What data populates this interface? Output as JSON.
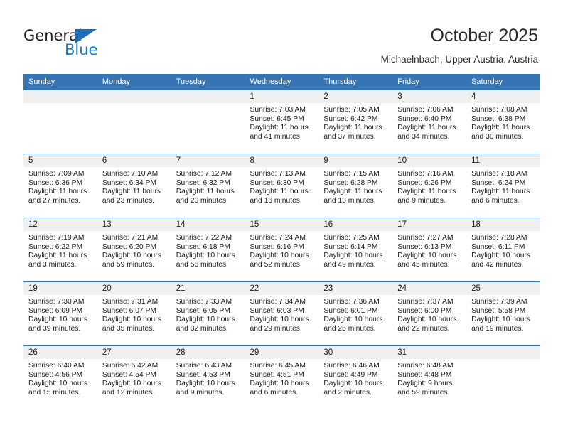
{
  "brand": {
    "name_part1": "General",
    "name_part2": "Blue",
    "triangle_color": "#1f6eb5",
    "blue_color": "#1d7cc4"
  },
  "header": {
    "title": "October 2025",
    "subtitle": "Michaelnbach, Upper Austria, Austria"
  },
  "theme": {
    "header_bg": "#3575b6",
    "daynum_bg": "#f0f0f0",
    "grid_line": "#3575b6",
    "text": "#1a1a1a"
  },
  "columns": [
    "Sunday",
    "Monday",
    "Tuesday",
    "Wednesday",
    "Thursday",
    "Friday",
    "Saturday"
  ],
  "weeks": [
    [
      {
        "day": "",
        "blank": true,
        "sunrise": "",
        "sunset": "",
        "daylight_line1": "",
        "daylight_line2": ""
      },
      {
        "day": "",
        "blank": true,
        "sunrise": "",
        "sunset": "",
        "daylight_line1": "",
        "daylight_line2": ""
      },
      {
        "day": "",
        "blank": true,
        "sunrise": "",
        "sunset": "",
        "daylight_line1": "",
        "daylight_line2": ""
      },
      {
        "day": "1",
        "blank": false,
        "sunrise": "Sunrise: 7:03 AM",
        "sunset": "Sunset: 6:45 PM",
        "daylight_line1": "Daylight: 11 hours",
        "daylight_line2": "and 41 minutes."
      },
      {
        "day": "2",
        "blank": false,
        "sunrise": "Sunrise: 7:05 AM",
        "sunset": "Sunset: 6:42 PM",
        "daylight_line1": "Daylight: 11 hours",
        "daylight_line2": "and 37 minutes."
      },
      {
        "day": "3",
        "blank": false,
        "sunrise": "Sunrise: 7:06 AM",
        "sunset": "Sunset: 6:40 PM",
        "daylight_line1": "Daylight: 11 hours",
        "daylight_line2": "and 34 minutes."
      },
      {
        "day": "4",
        "blank": false,
        "sunrise": "Sunrise: 7:08 AM",
        "sunset": "Sunset: 6:38 PM",
        "daylight_line1": "Daylight: 11 hours",
        "daylight_line2": "and 30 minutes."
      }
    ],
    [
      {
        "day": "5",
        "blank": false,
        "sunrise": "Sunrise: 7:09 AM",
        "sunset": "Sunset: 6:36 PM",
        "daylight_line1": "Daylight: 11 hours",
        "daylight_line2": "and 27 minutes."
      },
      {
        "day": "6",
        "blank": false,
        "sunrise": "Sunrise: 7:10 AM",
        "sunset": "Sunset: 6:34 PM",
        "daylight_line1": "Daylight: 11 hours",
        "daylight_line2": "and 23 minutes."
      },
      {
        "day": "7",
        "blank": false,
        "sunrise": "Sunrise: 7:12 AM",
        "sunset": "Sunset: 6:32 PM",
        "daylight_line1": "Daylight: 11 hours",
        "daylight_line2": "and 20 minutes."
      },
      {
        "day": "8",
        "blank": false,
        "sunrise": "Sunrise: 7:13 AM",
        "sunset": "Sunset: 6:30 PM",
        "daylight_line1": "Daylight: 11 hours",
        "daylight_line2": "and 16 minutes."
      },
      {
        "day": "9",
        "blank": false,
        "sunrise": "Sunrise: 7:15 AM",
        "sunset": "Sunset: 6:28 PM",
        "daylight_line1": "Daylight: 11 hours",
        "daylight_line2": "and 13 minutes."
      },
      {
        "day": "10",
        "blank": false,
        "sunrise": "Sunrise: 7:16 AM",
        "sunset": "Sunset: 6:26 PM",
        "daylight_line1": "Daylight: 11 hours",
        "daylight_line2": "and 9 minutes."
      },
      {
        "day": "11",
        "blank": false,
        "sunrise": "Sunrise: 7:18 AM",
        "sunset": "Sunset: 6:24 PM",
        "daylight_line1": "Daylight: 11 hours",
        "daylight_line2": "and 6 minutes."
      }
    ],
    [
      {
        "day": "12",
        "blank": false,
        "sunrise": "Sunrise: 7:19 AM",
        "sunset": "Sunset: 6:22 PM",
        "daylight_line1": "Daylight: 11 hours",
        "daylight_line2": "and 3 minutes."
      },
      {
        "day": "13",
        "blank": false,
        "sunrise": "Sunrise: 7:21 AM",
        "sunset": "Sunset: 6:20 PM",
        "daylight_line1": "Daylight: 10 hours",
        "daylight_line2": "and 59 minutes."
      },
      {
        "day": "14",
        "blank": false,
        "sunrise": "Sunrise: 7:22 AM",
        "sunset": "Sunset: 6:18 PM",
        "daylight_line1": "Daylight: 10 hours",
        "daylight_line2": "and 56 minutes."
      },
      {
        "day": "15",
        "blank": false,
        "sunrise": "Sunrise: 7:24 AM",
        "sunset": "Sunset: 6:16 PM",
        "daylight_line1": "Daylight: 10 hours",
        "daylight_line2": "and 52 minutes."
      },
      {
        "day": "16",
        "blank": false,
        "sunrise": "Sunrise: 7:25 AM",
        "sunset": "Sunset: 6:14 PM",
        "daylight_line1": "Daylight: 10 hours",
        "daylight_line2": "and 49 minutes."
      },
      {
        "day": "17",
        "blank": false,
        "sunrise": "Sunrise: 7:27 AM",
        "sunset": "Sunset: 6:13 PM",
        "daylight_line1": "Daylight: 10 hours",
        "daylight_line2": "and 45 minutes."
      },
      {
        "day": "18",
        "blank": false,
        "sunrise": "Sunrise: 7:28 AM",
        "sunset": "Sunset: 6:11 PM",
        "daylight_line1": "Daylight: 10 hours",
        "daylight_line2": "and 42 minutes."
      }
    ],
    [
      {
        "day": "19",
        "blank": false,
        "sunrise": "Sunrise: 7:30 AM",
        "sunset": "Sunset: 6:09 PM",
        "daylight_line1": "Daylight: 10 hours",
        "daylight_line2": "and 39 minutes."
      },
      {
        "day": "20",
        "blank": false,
        "sunrise": "Sunrise: 7:31 AM",
        "sunset": "Sunset: 6:07 PM",
        "daylight_line1": "Daylight: 10 hours",
        "daylight_line2": "and 35 minutes."
      },
      {
        "day": "21",
        "blank": false,
        "sunrise": "Sunrise: 7:33 AM",
        "sunset": "Sunset: 6:05 PM",
        "daylight_line1": "Daylight: 10 hours",
        "daylight_line2": "and 32 minutes."
      },
      {
        "day": "22",
        "blank": false,
        "sunrise": "Sunrise: 7:34 AM",
        "sunset": "Sunset: 6:03 PM",
        "daylight_line1": "Daylight: 10 hours",
        "daylight_line2": "and 29 minutes."
      },
      {
        "day": "23",
        "blank": false,
        "sunrise": "Sunrise: 7:36 AM",
        "sunset": "Sunset: 6:01 PM",
        "daylight_line1": "Daylight: 10 hours",
        "daylight_line2": "and 25 minutes."
      },
      {
        "day": "24",
        "blank": false,
        "sunrise": "Sunrise: 7:37 AM",
        "sunset": "Sunset: 6:00 PM",
        "daylight_line1": "Daylight: 10 hours",
        "daylight_line2": "and 22 minutes."
      },
      {
        "day": "25",
        "blank": false,
        "sunrise": "Sunrise: 7:39 AM",
        "sunset": "Sunset: 5:58 PM",
        "daylight_line1": "Daylight: 10 hours",
        "daylight_line2": "and 19 minutes."
      }
    ],
    [
      {
        "day": "26",
        "blank": false,
        "sunrise": "Sunrise: 6:40 AM",
        "sunset": "Sunset: 4:56 PM",
        "daylight_line1": "Daylight: 10 hours",
        "daylight_line2": "and 15 minutes."
      },
      {
        "day": "27",
        "blank": false,
        "sunrise": "Sunrise: 6:42 AM",
        "sunset": "Sunset: 4:54 PM",
        "daylight_line1": "Daylight: 10 hours",
        "daylight_line2": "and 12 minutes."
      },
      {
        "day": "28",
        "blank": false,
        "sunrise": "Sunrise: 6:43 AM",
        "sunset": "Sunset: 4:53 PM",
        "daylight_line1": "Daylight: 10 hours",
        "daylight_line2": "and 9 minutes."
      },
      {
        "day": "29",
        "blank": false,
        "sunrise": "Sunrise: 6:45 AM",
        "sunset": "Sunset: 4:51 PM",
        "daylight_line1": "Daylight: 10 hours",
        "daylight_line2": "and 6 minutes."
      },
      {
        "day": "30",
        "blank": false,
        "sunrise": "Sunrise: 6:46 AM",
        "sunset": "Sunset: 4:49 PM",
        "daylight_line1": "Daylight: 10 hours",
        "daylight_line2": "and 2 minutes."
      },
      {
        "day": "31",
        "blank": false,
        "sunrise": "Sunrise: 6:48 AM",
        "sunset": "Sunset: 4:48 PM",
        "daylight_line1": "Daylight: 9 hours",
        "daylight_line2": "and 59 minutes."
      },
      {
        "day": "",
        "blank": true,
        "sunrise": "",
        "sunset": "",
        "daylight_line1": "",
        "daylight_line2": ""
      }
    ]
  ]
}
